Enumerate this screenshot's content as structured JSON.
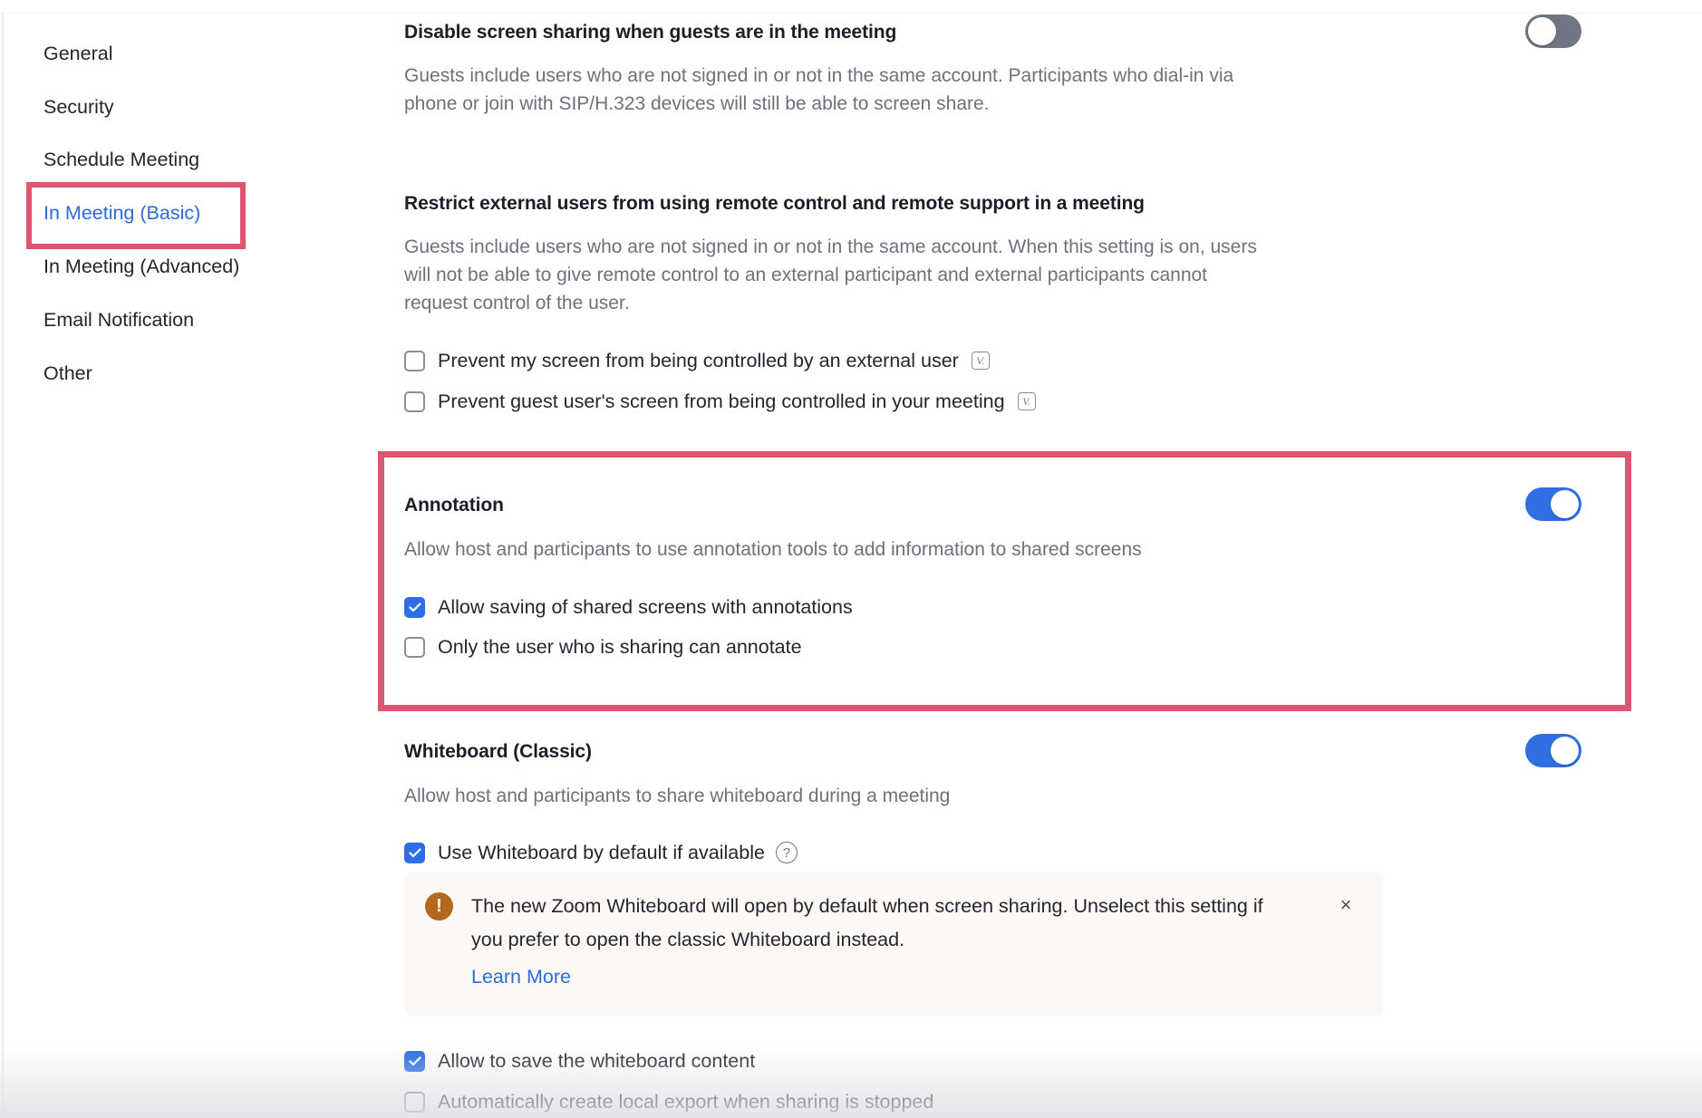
{
  "sidebar": {
    "items": [
      {
        "label": "General",
        "active": false
      },
      {
        "label": "Security",
        "active": false
      },
      {
        "label": "Schedule Meeting",
        "active": false
      },
      {
        "label": "In Meeting (Basic)",
        "active": true
      },
      {
        "label": "In Meeting (Advanced)",
        "active": false
      },
      {
        "label": "Email Notification",
        "active": false
      },
      {
        "label": "Other",
        "active": false
      }
    ]
  },
  "settings": {
    "disable_screen_sharing": {
      "title": "Disable screen sharing when guests are in the meeting",
      "desc_line1": "Guests include users who are not signed in or not in the same account. Participants who dial-in via",
      "desc_line2": "phone or join with SIP/H.323 devices will still be able to screen share.",
      "enabled": false
    },
    "restrict_remote_control": {
      "title": "Restrict external users from using remote control and remote support in a meeting",
      "desc_line1": "Guests include users who are not signed in or not in the same account. When this setting is on, users",
      "desc_line2": "will not be able to give remote control to an external participant and external participants cannot",
      "desc_line3": "request control of the user.",
      "options": [
        {
          "label": "Prevent my screen from being controlled by an external user",
          "checked": false,
          "icon": "version-badge-icon"
        },
        {
          "label": "Prevent guest user's screen from being controlled in your meeting",
          "checked": false,
          "icon": "version-badge-icon"
        }
      ],
      "badge_glyph": "V."
    },
    "annotation": {
      "title": "Annotation",
      "desc": "Allow host and participants to use annotation tools to add information to shared screens",
      "enabled": true,
      "options": [
        {
          "label": "Allow saving of shared screens with annotations",
          "checked": true
        },
        {
          "label": "Only the user who is sharing can annotate",
          "checked": false
        }
      ]
    },
    "whiteboard": {
      "title": "Whiteboard (Classic)",
      "desc": "Allow host and participants to share whiteboard during a meeting",
      "enabled": true,
      "default_option": {
        "label": "Use Whiteboard by default if available",
        "checked": true,
        "help_glyph": "?"
      },
      "notice": {
        "icon_glyph": "!",
        "text": "The new Zoom Whiteboard will open by default when screen sharing. Unselect this setting if you prefer to open the classic Whiteboard instead.",
        "link": "Learn More",
        "close_glyph": "×"
      },
      "options": [
        {
          "label": "Allow to save the whiteboard content",
          "checked": true
        },
        {
          "label": "Automatically create local export when sharing is stopped",
          "checked": false
        }
      ]
    }
  },
  "colors": {
    "accent": "#2d6de6",
    "highlight": "#de5572",
    "toggle_off": "#6e7683",
    "warning": "#b5661f",
    "notice_bg": "#fdf8f3"
  }
}
